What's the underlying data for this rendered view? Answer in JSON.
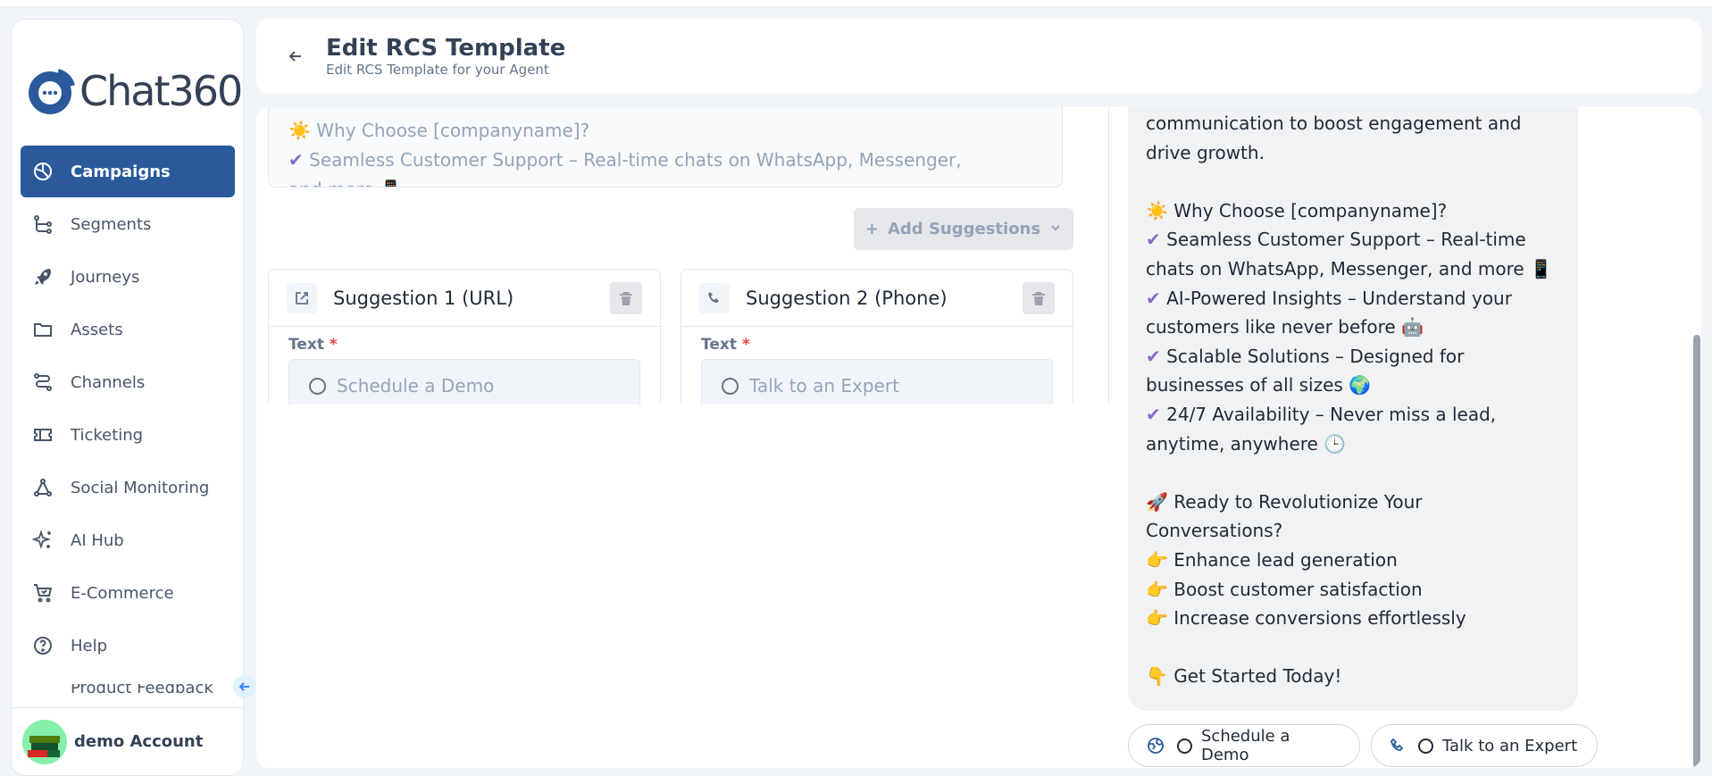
{
  "brand": {
    "logo_text": "Chat360"
  },
  "sidebar": {
    "items": [
      {
        "label": "Campaigns",
        "icon": "pie-chart-icon",
        "active": true
      },
      {
        "label": "Segments",
        "icon": "segments-icon"
      },
      {
        "label": "Journeys",
        "icon": "rocket-icon"
      },
      {
        "label": "Assets",
        "icon": "folder-icon"
      },
      {
        "label": "Channels",
        "icon": "channels-icon"
      },
      {
        "label": "Ticketing",
        "icon": "ticket-icon"
      },
      {
        "label": "Social Monitoring",
        "icon": "network-icon"
      },
      {
        "label": "AI Hub",
        "icon": "sparkles-icon"
      },
      {
        "label": "E-Commerce",
        "icon": "cart-icon"
      },
      {
        "label": "Help",
        "icon": "help-icon"
      }
    ],
    "cut_item": "Product Feedback",
    "account": "demo Account"
  },
  "header": {
    "title": "Edit RCS Template",
    "subtitle": "Edit RCS Template for your Agent"
  },
  "editor": {
    "message_lines": [
      "☀️ Why Choose [companyname]?",
      "✔ Seamless Customer Support – Real-time chats on WhatsApp, Messenger,",
      "and more 📱"
    ],
    "add_suggestions_label": "Add Suggestions",
    "suggestions": [
      {
        "title": "Suggestion 1 (URL)",
        "text_label": "Text",
        "placeholder": "Schedule a Demo",
        "icon": "external-link-icon"
      },
      {
        "title": "Suggestion 2 (Phone)",
        "text_label": "Text",
        "placeholder": "Talk to an Expert",
        "icon": "phone-icon"
      }
    ],
    "required_mark": "*"
  },
  "preview": {
    "message": "communication to boost engagement and drive growth.\n\n☀️ Why Choose [companyname]?\n✔ Seamless Customer Support – Real-time chats on WhatsApp, Messenger, and more 📱\n✔ AI-Powered Insights – Understand your customers like never before 🤖\n✔ Scalable Solutions – Designed for businesses of all sizes 🌍\n✔ 24/7 Availability – Never miss a lead, anytime, anywhere 🕒\n\n🚀 Ready to Revolutionize Your Conversations?\n👉 Enhance lead generation\n👉 Boost customer satisfaction\n👉 Increase conversions effortlessly\n\n👇 Get Started Today!",
    "chips": [
      {
        "label": "Schedule a Demo",
        "icon": "globe-icon"
      },
      {
        "label": "Talk to an Expert",
        "icon": "phone-icon"
      }
    ]
  },
  "colors": {
    "primary": "#2a5a9b",
    "accent_check": "#7c5cc4"
  }
}
